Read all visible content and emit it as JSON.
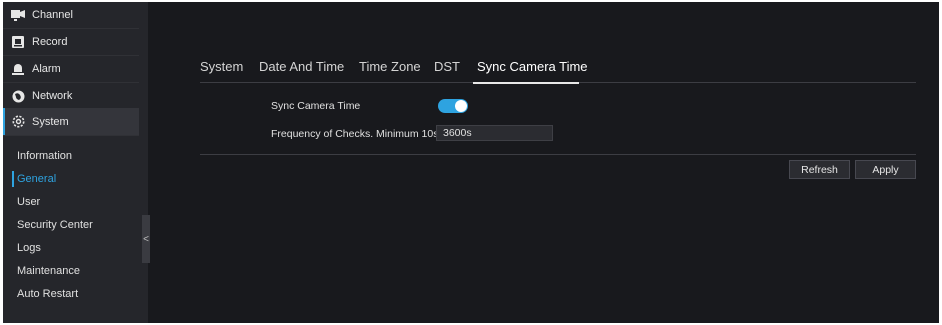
{
  "sidebar": {
    "top_items": [
      {
        "label": "Channel",
        "icon": "camera-icon"
      },
      {
        "label": "Record",
        "icon": "record-icon"
      },
      {
        "label": "Alarm",
        "icon": "alarm-icon"
      },
      {
        "label": "Network",
        "icon": "network-icon"
      },
      {
        "label": "System",
        "icon": "gear-icon"
      }
    ],
    "sub_items": [
      {
        "label": "Information"
      },
      {
        "label": "General"
      },
      {
        "label": "User"
      },
      {
        "label": "Security Center"
      },
      {
        "label": "Logs"
      },
      {
        "label": "Maintenance"
      },
      {
        "label": "Auto Restart"
      }
    ],
    "collapse_glyph": "<"
  },
  "tabs": [
    {
      "label": "System"
    },
    {
      "label": "Date And Time"
    },
    {
      "label": "Time Zone"
    },
    {
      "label": "DST"
    },
    {
      "label": "Sync Camera Time"
    }
  ],
  "form": {
    "sync_label": "Sync Camera Time",
    "sync_enabled": true,
    "frequency_label": "Frequency of Checks. Minimum 10s",
    "frequency_value": "3600s"
  },
  "buttons": {
    "refresh": "Refresh",
    "apply": "Apply"
  },
  "colors": {
    "accent": "#2ea3e0",
    "background": "#18191d",
    "sidebar": "#25262b"
  }
}
